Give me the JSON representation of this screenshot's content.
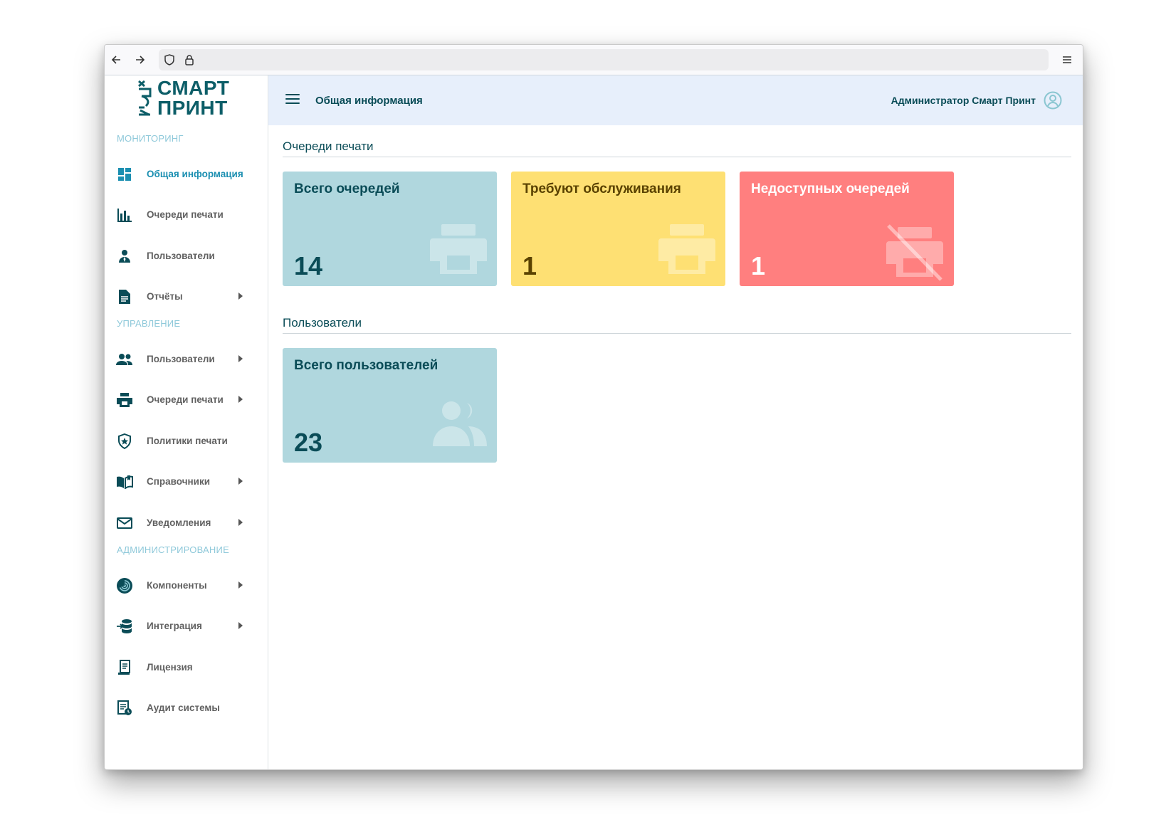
{
  "app": {
    "logo_line1": "СМАРТ",
    "logo_line2": "ПРИНТ",
    "accent_color": "#0d5e68"
  },
  "sidebar": {
    "sections": [
      {
        "title": "МОНИТОРИНГ",
        "items": [
          {
            "label": "Общая информация",
            "icon": "dashboard-icon",
            "active": true,
            "has_submenu": false
          },
          {
            "label": "Очереди печати",
            "icon": "bar-chart-icon",
            "active": false,
            "has_submenu": false
          },
          {
            "label": "Пользователи",
            "icon": "user-tie-icon",
            "active": false,
            "has_submenu": false
          },
          {
            "label": "Отчёты",
            "icon": "document-icon",
            "active": false,
            "has_submenu": true
          }
        ]
      },
      {
        "title": "УПРАВЛЕНИЕ",
        "items": [
          {
            "label": "Пользователи",
            "icon": "group-icon",
            "active": false,
            "has_submenu": true
          },
          {
            "label": "Очереди печати",
            "icon": "printer-icon",
            "active": false,
            "has_submenu": true
          },
          {
            "label": "Политики печати",
            "icon": "shield-star-icon",
            "active": false,
            "has_submenu": false
          },
          {
            "label": "Справочники",
            "icon": "book-icon",
            "active": false,
            "has_submenu": true
          },
          {
            "label": "Уведомления",
            "icon": "mail-icon",
            "active": false,
            "has_submenu": true
          }
        ]
      },
      {
        "title": "АДМИНИСТРИРОВАНИЕ",
        "items": [
          {
            "label": "Компоненты",
            "icon": "swirl-icon",
            "active": false,
            "has_submenu": true
          },
          {
            "label": "Интеграция",
            "icon": "database-import-icon",
            "active": false,
            "has_submenu": true
          },
          {
            "label": "Лицензия",
            "icon": "license-icon",
            "active": false,
            "has_submenu": false
          },
          {
            "label": "Аудит системы",
            "icon": "audit-icon",
            "active": false,
            "has_submenu": false
          }
        ]
      }
    ]
  },
  "header": {
    "title": "Общая информация",
    "user_name": "Администратор Смарт Принт"
  },
  "main": {
    "queues_section": {
      "heading": "Очереди печати",
      "cards": [
        {
          "title": "Всего очередей",
          "value": "14",
          "bg": "#b0d7de",
          "fg": "#0a4c57",
          "icon": "printer-icon"
        },
        {
          "title": "Требуют обслуживания",
          "value": "1",
          "bg": "#fee073",
          "fg": "#5a4200",
          "icon": "printer-icon"
        },
        {
          "title": "Недоступных очередей",
          "value": "1",
          "bg": "#ff7f7f",
          "fg": "#ffffff",
          "icon": "printer-off-icon"
        }
      ]
    },
    "users_section": {
      "heading": "Пользователи",
      "cards": [
        {
          "title": "Всего пользователей",
          "value": "23",
          "bg": "#b0d7de",
          "fg": "#0a4c57",
          "icon": "users-icon"
        }
      ]
    }
  }
}
